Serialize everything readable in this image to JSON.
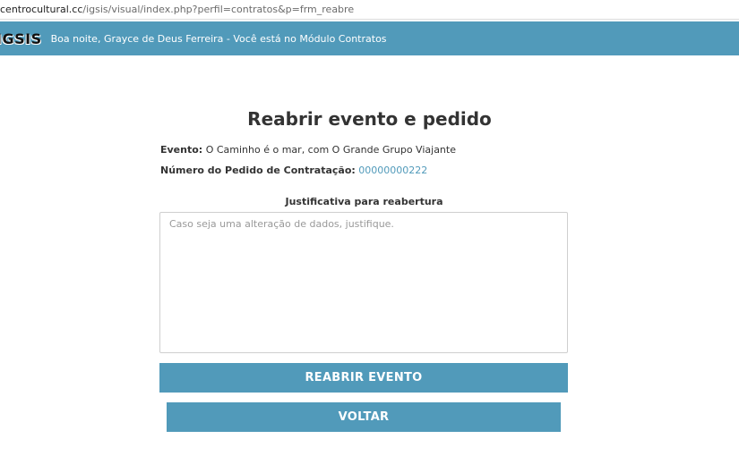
{
  "browser": {
    "url_domain": "centrocultural.cc",
    "url_path": "/igsis/visual/index.php?perfil=contratos&p=frm_reabre"
  },
  "header": {
    "logo": "IGSIS",
    "greeting": "Boa noite, Grayce de Deus Ferreira - Você está no Módulo Contratos"
  },
  "main": {
    "title": "Reabrir evento e pedido",
    "evento_label": "Evento:",
    "evento_value": "O Caminho é o mar, com O Grande Grupo Viajante",
    "pedido_label": "Número do Pedido de Contratação:",
    "pedido_value": "00000000222",
    "justificativa_label": "Justificativa para reabertura",
    "justificativa_placeholder": "Caso seja uma alteração de dados, justifique.",
    "justificativa_value": "",
    "reabrir_button": "REABRIR EVENTO",
    "voltar_button": "VOLTAR"
  },
  "colors": {
    "accent": "#519aba",
    "text": "#333333"
  }
}
